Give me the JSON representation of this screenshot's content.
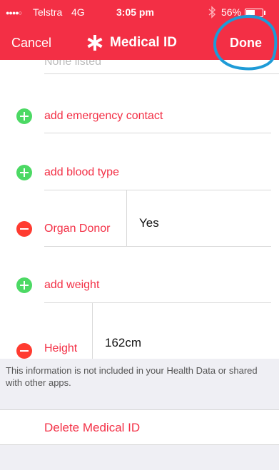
{
  "status_bar": {
    "signal": "●●●●○",
    "carrier": "Telstra",
    "network": "4G",
    "time": "3:05 pm",
    "battery": "56%"
  },
  "nav": {
    "cancel_label": "Cancel",
    "title": "Medical ID",
    "done_label": "Done"
  },
  "fields": {
    "none_listed": "None listed",
    "add_emergency_contact": "add emergency contact",
    "add_blood_type": "add blood type",
    "organ_donor_label": "Organ Donor",
    "organ_donor_value": "Yes",
    "add_weight": "add weight",
    "height_label": "Height",
    "height_value": "162cm"
  },
  "footer": {
    "note": "This information is not included in your Health Data or shared with other apps.",
    "delete_label": "Delete Medical ID"
  },
  "colors": {
    "header": "#f32f45",
    "add": "#4cd964",
    "remove": "#ff3b30",
    "annotation_ring": "#1e9bd7"
  }
}
